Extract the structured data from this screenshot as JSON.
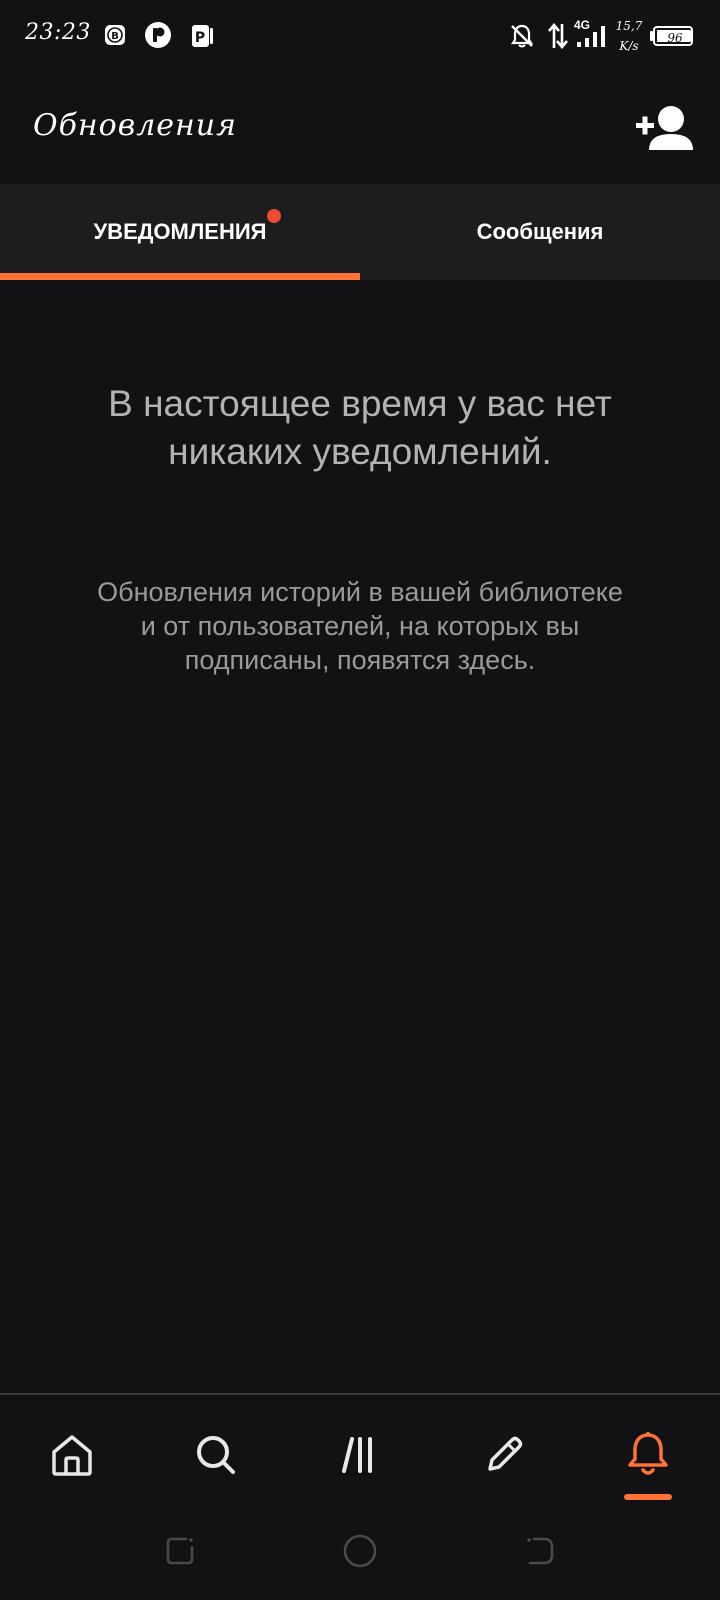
{
  "status_bar": {
    "time": "23:23",
    "network": "4G",
    "speed_value": "15,7",
    "speed_unit": "K/s",
    "battery": "96"
  },
  "header": {
    "title": "Обновления",
    "add_user_icon": "add-user-icon"
  },
  "tabs": [
    {
      "label": "УВЕДОМЛЕНИЯ",
      "active": true,
      "has_badge": true
    },
    {
      "label": "Сообщения",
      "active": false,
      "has_badge": false
    }
  ],
  "empty_state": {
    "title": "В настоящее время у вас нет никаких уведомлений.",
    "subtitle": "Обновления историй в вашей библиотеке и от пользователей, на которых вы подписаны, появятся здесь."
  },
  "bottom_nav": {
    "items": [
      {
        "icon": "home-icon",
        "active": false
      },
      {
        "icon": "search-icon",
        "active": false
      },
      {
        "icon": "library-icon",
        "active": false
      },
      {
        "icon": "pencil-icon",
        "active": false
      },
      {
        "icon": "bell-icon",
        "active": true
      }
    ]
  },
  "colors": {
    "accent": "#ff7135",
    "badge": "#ea4c2f",
    "background": "#121114",
    "tab_background": "#1d1c1f",
    "muted_text": "#b3b2b5"
  }
}
